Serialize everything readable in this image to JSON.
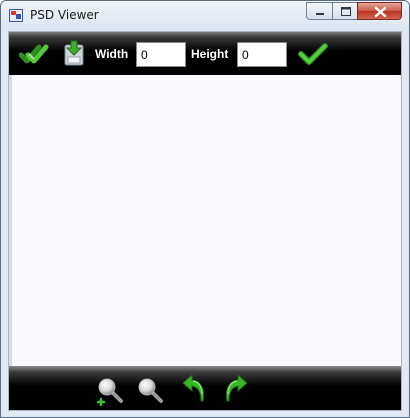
{
  "window": {
    "title": "PSD Viewer",
    "icons": {
      "app": "app-icon",
      "minimize": "minimize-icon",
      "maximize": "maximize-icon",
      "close": "close-icon"
    }
  },
  "toolbar": {
    "width_label": "Width",
    "width_value": "0",
    "height_label": "Height",
    "height_value": "0",
    "icons": {
      "open": "double-check-icon",
      "save": "save-download-icon",
      "apply": "checkmark-icon"
    }
  },
  "bottombar": {
    "icons": [
      "zoom-in-icon",
      "zoom-out-icon",
      "rotate-left-icon",
      "rotate-right-icon"
    ]
  },
  "colors": {
    "toolbar_bg": "#000000",
    "accent_green": "#3fbf2a",
    "canvas_bg": "#f8f8fd",
    "close_button": "#c8503c"
  }
}
